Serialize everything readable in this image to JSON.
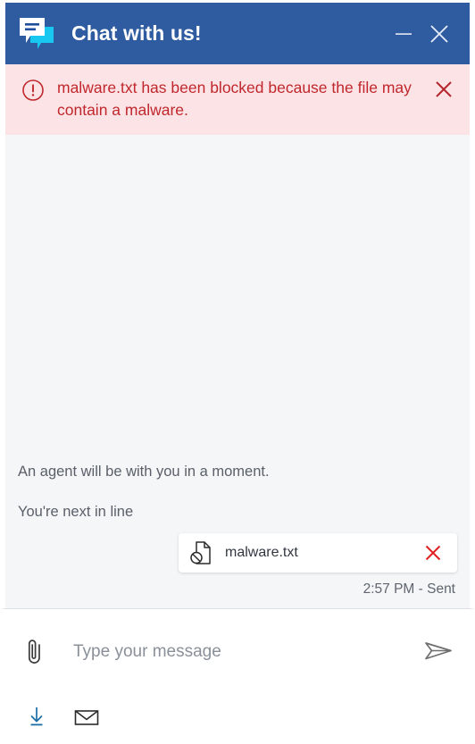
{
  "window": {
    "title": "Chat with us!",
    "brand_icon": "chat-bubbles-icon",
    "minimize_label": "Minimize",
    "close_label": "Close",
    "header_color": "#2f5ca0"
  },
  "alert": {
    "icon": "exclamation-circle-icon",
    "message": "malware.txt has been blocked because the file may contain a malware.",
    "close_label": "Dismiss",
    "background_color": "#fce4e6",
    "text_color": "#c0272d"
  },
  "conversation": {
    "system_messages": [
      "An agent will be with you in a moment.",
      "You're next in line"
    ],
    "attachment": {
      "icon": "blocked-file-icon",
      "filename": "malware.txt",
      "remove_label": "Remove",
      "remove_color": "#e02020"
    },
    "status": "2:57 PM - Sent"
  },
  "composer": {
    "attach_icon": "paperclip-icon",
    "placeholder": "Type your message",
    "value": "",
    "send_icon": "send-plane-icon",
    "tools": [
      {
        "icon": "download-icon",
        "label": "Download transcript",
        "color": "#1b6ea5"
      },
      {
        "icon": "envelope-icon",
        "label": "Email transcript",
        "color": "#333840"
      }
    ]
  }
}
